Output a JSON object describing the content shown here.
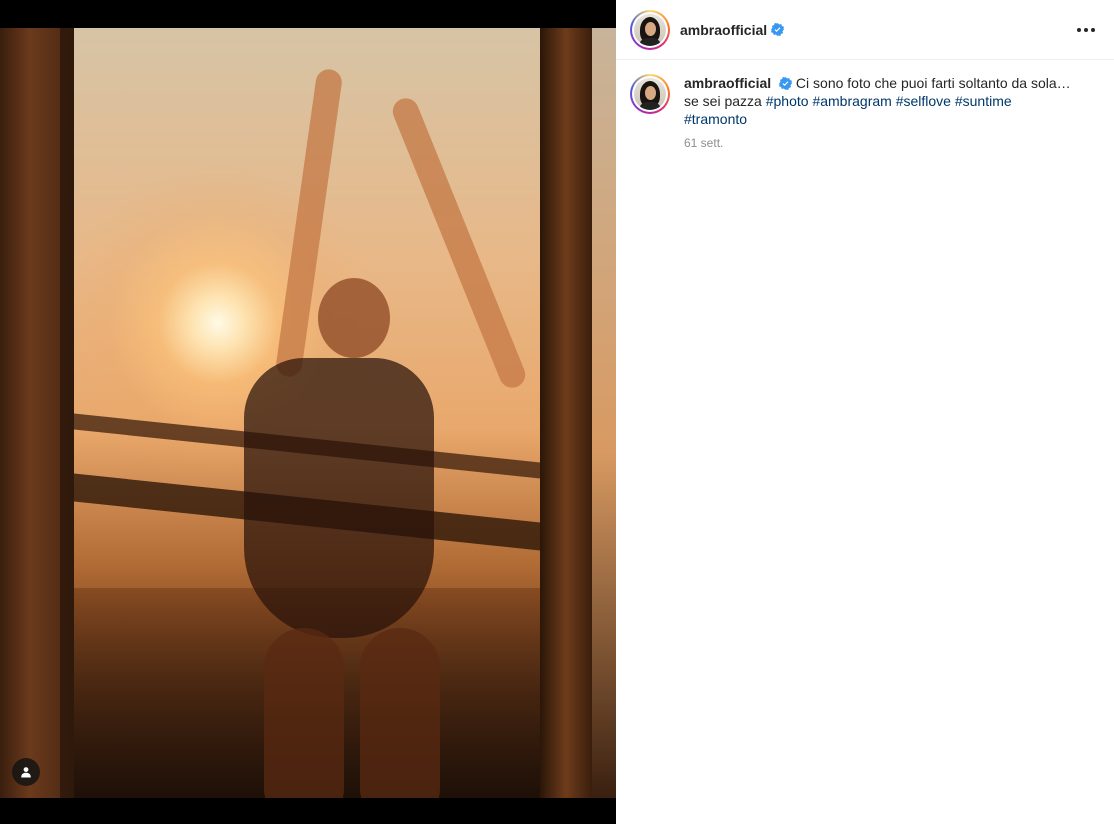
{
  "post": {
    "username": "ambraofficial",
    "verified": true,
    "caption": {
      "username": "ambraofficial",
      "text_line1": "Ci sono foto che puoi farti soltanto da sola…",
      "text_line2_prefix": "se sei pazza",
      "hashtags": [
        "#photo",
        "#ambragram",
        "#selflove",
        "#suntime",
        "#tramonto"
      ]
    },
    "timestamp": "61 sett."
  },
  "icons": {
    "more": "more-options-icon",
    "verified": "verified-badge-icon",
    "user_tags": "user-tag-icon"
  },
  "colors": {
    "link": "#00376b",
    "verified": "#3897f0",
    "text": "#262626",
    "muted": "#8e8e8e"
  }
}
